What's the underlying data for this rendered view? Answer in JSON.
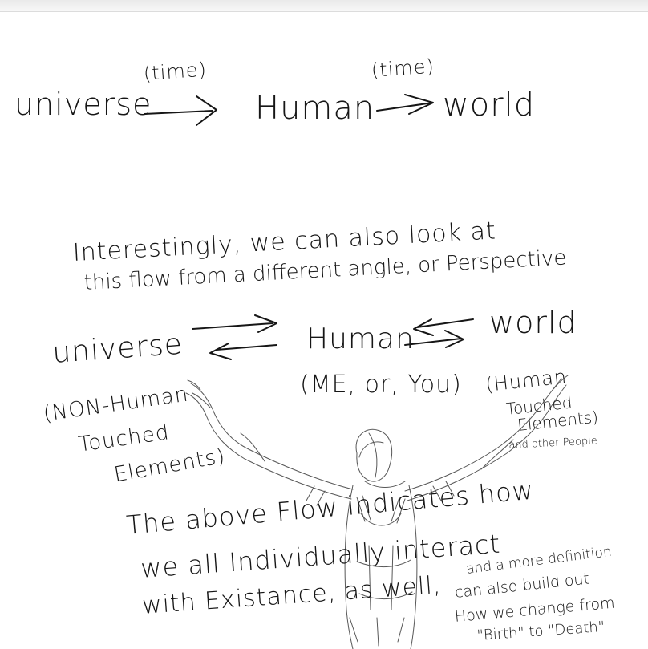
{
  "diagram1": {
    "universe": "universe",
    "time1": "(time)",
    "human": "Human",
    "time2": "(time)",
    "world": "world"
  },
  "paragraph1": {
    "line1": "Interestingly, we can also look at",
    "line2": "this flow from a different angle, or Perspective"
  },
  "diagram2": {
    "universe": "universe",
    "human": "Human",
    "world": "world",
    "human_note": "(ME, or, You)",
    "universe_note_1": "(NON-Human",
    "universe_note_2": "Touched",
    "universe_note_3": "Elements)",
    "world_note_1": "(Human",
    "world_note_2": "Touched",
    "world_note_3": "Elements)",
    "world_note_4": "and other People"
  },
  "paragraph2": {
    "line1": "The above Flow indicates how",
    "line2": "we all Individually interact",
    "line3": "with Existance, as well,"
  },
  "side_note": {
    "line1": "and a more definition",
    "line2": "can also build out",
    "line3": "How we change from",
    "line4": "\"Birth\" to \"Death\""
  }
}
